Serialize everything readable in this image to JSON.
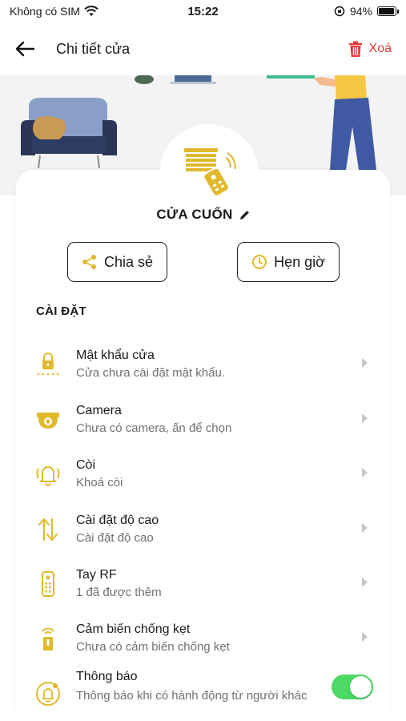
{
  "status": {
    "carrier": "Không có SIM",
    "time": "15:22",
    "battery_text": "94%",
    "battery_level": 0.94
  },
  "nav": {
    "title": "Chi tiết cửa",
    "delete_label": "Xoá"
  },
  "device": {
    "name": "CỬA CUỐN"
  },
  "actions": {
    "share_label": "Chia sẻ",
    "schedule_label": "Hẹn giờ"
  },
  "settings": {
    "section_title": "CÀI ĐẶT",
    "items": [
      {
        "title": "Mật khẩu cửa",
        "subtitle": "Cửa chưa cài đặt mật khẩu.",
        "icon": "lock-icon"
      },
      {
        "title": "Camera",
        "subtitle": "Chưa có camera, ấn để chọn",
        "icon": "camera-icon"
      },
      {
        "title": "Còi",
        "subtitle": "Khoá còi",
        "icon": "bell-icon"
      },
      {
        "title": "Cài đặt độ cao",
        "subtitle": "Cài đặt độ cao",
        "icon": "height-arrows-icon"
      },
      {
        "title": "Tay RF",
        "subtitle": "1 đã được thêm",
        "icon": "remote-icon"
      },
      {
        "title": "Cảm biến chống kẹt",
        "subtitle": "Chưa có cảm biến chống kẹt",
        "icon": "sensor-icon"
      }
    ],
    "notification": {
      "title": "Thông báo",
      "subtitle": "Thông báo khi có hành động từ người khác",
      "enabled": true,
      "icon": "notification-bell-icon"
    }
  },
  "colors": {
    "accent": "#e0b92c",
    "danger": "#e53935",
    "toggle_on": "#4cd964",
    "subtitle": "#707070"
  }
}
